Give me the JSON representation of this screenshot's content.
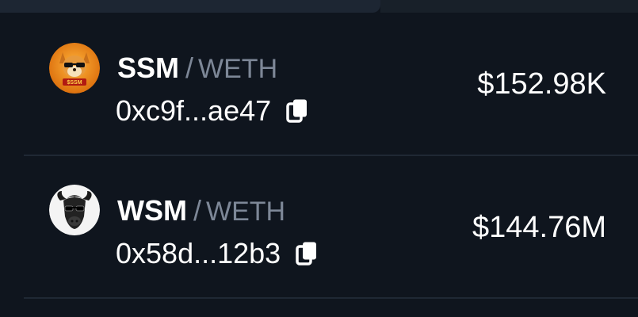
{
  "pairs": [
    {
      "base": "SSM",
      "separator": "/",
      "quote": "WETH",
      "address": "0xc9f...ae47",
      "value": "$152.98K",
      "avatar_icon": "ssm-doge-logo-icon",
      "avatar_label": "$SSM"
    },
    {
      "base": "WSM",
      "separator": "/",
      "quote": "WETH",
      "address": "0x58d...12b3",
      "value": "$144.76M",
      "avatar_icon": "wsm-bull-logo-icon"
    }
  ],
  "colors": {
    "background": "#0f151e",
    "muted_text": "#7d8797",
    "divider": "#1f2834"
  }
}
